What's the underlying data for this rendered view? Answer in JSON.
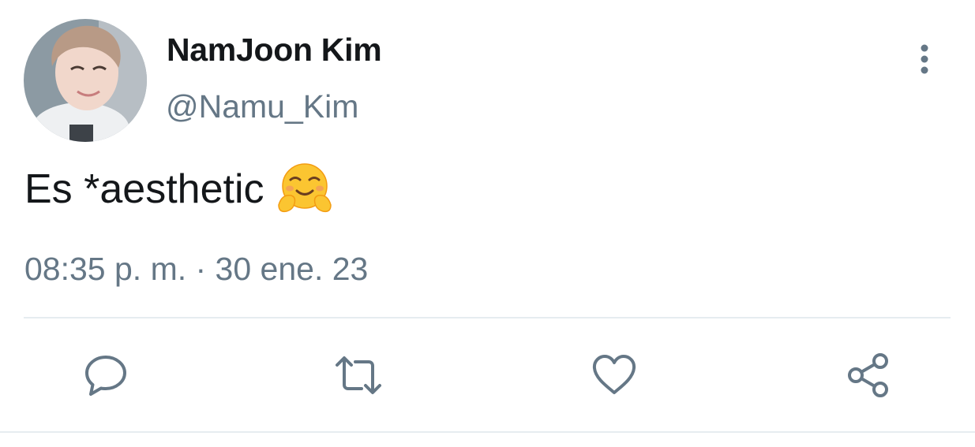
{
  "tweet": {
    "author": {
      "display_name": "NamJoon Kim",
      "handle": "@Namu_Kim",
      "avatar": "profile-photo"
    },
    "text": "Es *aesthetic",
    "emoji": "hugging-face",
    "timestamp": "08:35 p. m. · 30 ene. 23"
  },
  "actions": [
    {
      "name": "reply",
      "icon": "speech-bubble-icon"
    },
    {
      "name": "retweet",
      "icon": "retweet-icon"
    },
    {
      "name": "like",
      "icon": "heart-icon"
    },
    {
      "name": "share",
      "icon": "share-icon"
    }
  ],
  "colors": {
    "text": "#14171a",
    "secondary": "#657786",
    "divider": "#e6ecf0"
  }
}
